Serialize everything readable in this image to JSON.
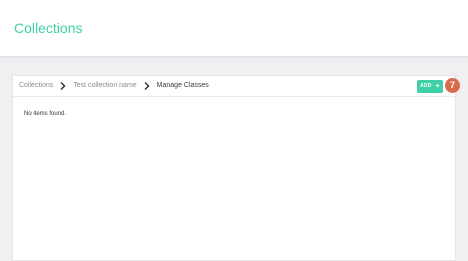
{
  "header": {
    "title": "Collections"
  },
  "breadcrumb": {
    "items": [
      "Collections",
      "Test collection name",
      "Manage Classes"
    ]
  },
  "toolbar": {
    "add_label": "ADD",
    "add_icon": "plus-icon",
    "add_icon_glyph": "+"
  },
  "badge": {
    "count": "7"
  },
  "content": {
    "empty_message": "No items found."
  },
  "colors": {
    "accent": "#3fcfa6",
    "badge": "#d96a4c",
    "background": "#f0f0f3"
  }
}
